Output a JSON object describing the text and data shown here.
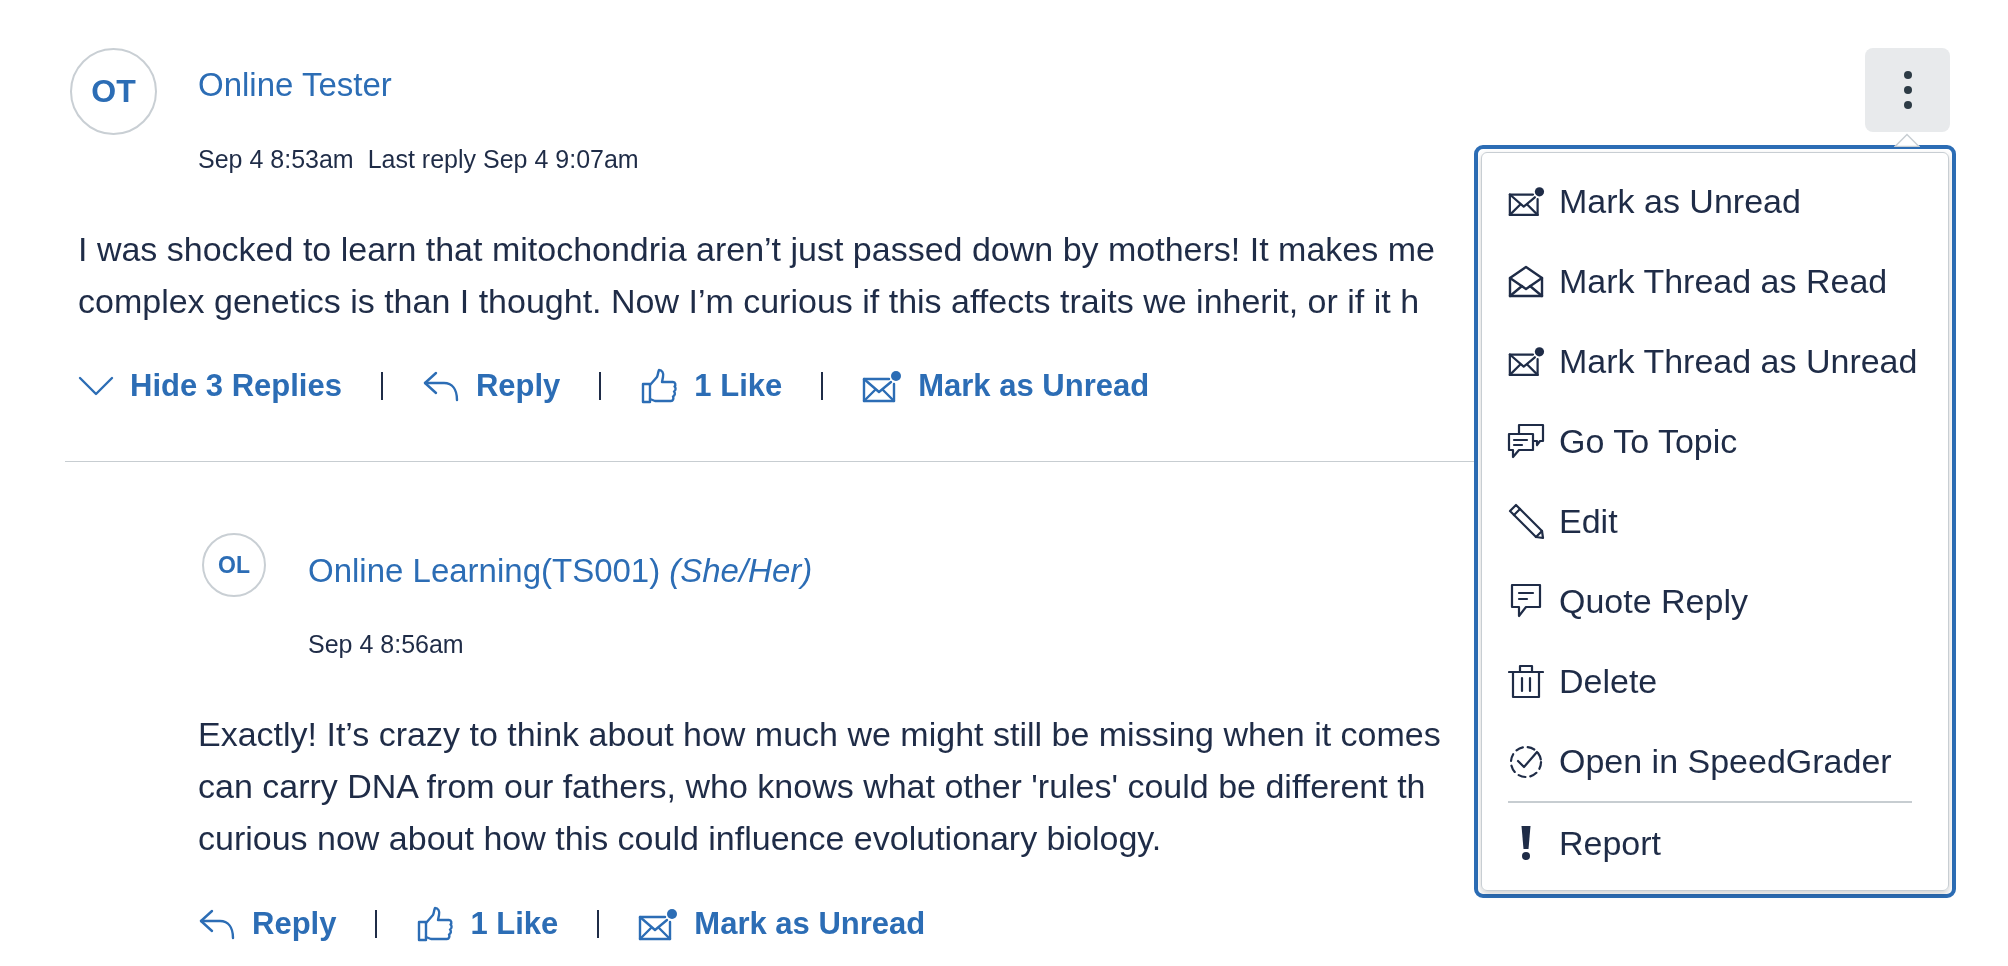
{
  "thread": {
    "author": {
      "initials": "OT",
      "name": "Online Tester"
    },
    "posted": "Sep 4 8:53am",
    "last_reply": "Last reply Sep 4 9:07am",
    "body_lines": [
      "I was shocked to learn that mitochondria aren’t just passed down by mothers! It makes me",
      "complex genetics is than I thought. Now I’m curious if this affects traits we inherit, or if it h"
    ],
    "replies_expanded": true,
    "actions": [
      {
        "kind": "toggle",
        "label": "Hide 3 Replies"
      },
      {
        "kind": "reply",
        "label": "Reply"
      },
      {
        "kind": "like",
        "label": "1 Like"
      },
      {
        "kind": "unread",
        "label": "Mark as Unread"
      }
    ],
    "replies": [
      {
        "author": {
          "initials": "OL",
          "name": "Online Learning(TS001)",
          "pronouns": "(She/Her)"
        },
        "posted": "Sep 4 8:56am",
        "body_lines": [
          "Exactly! It’s crazy to think about how much we might still be missing when it comes",
          "can carry DNA from our fathers, who knows what other 'rules' could be different th",
          "curious now about how this could influence evolutionary biology."
        ],
        "actions": [
          {
            "kind": "reply",
            "label": "Reply"
          },
          {
            "kind": "like",
            "label": "1 Like"
          },
          {
            "kind": "unread",
            "label": "Mark as Unread"
          }
        ]
      }
    ]
  },
  "more_button": {
    "expanded": true
  },
  "menu": {
    "sections": [
      {
        "items": [
          {
            "kind": "unread",
            "label": "Mark as Unread"
          },
          {
            "kind": "read",
            "label": "Mark Thread as Read"
          },
          {
            "kind": "unread",
            "label": "Mark Thread as Unread"
          },
          {
            "kind": "topic",
            "label": "Go To Topic"
          },
          {
            "kind": "edit",
            "label": "Edit"
          },
          {
            "kind": "quote",
            "label": "Quote Reply"
          },
          {
            "kind": "delete",
            "label": "Delete"
          },
          {
            "kind": "grade",
            "label": "Open in SpeedGrader"
          }
        ]
      },
      {
        "items": [
          {
            "kind": "report",
            "label": "Report"
          }
        ]
      }
    ]
  }
}
